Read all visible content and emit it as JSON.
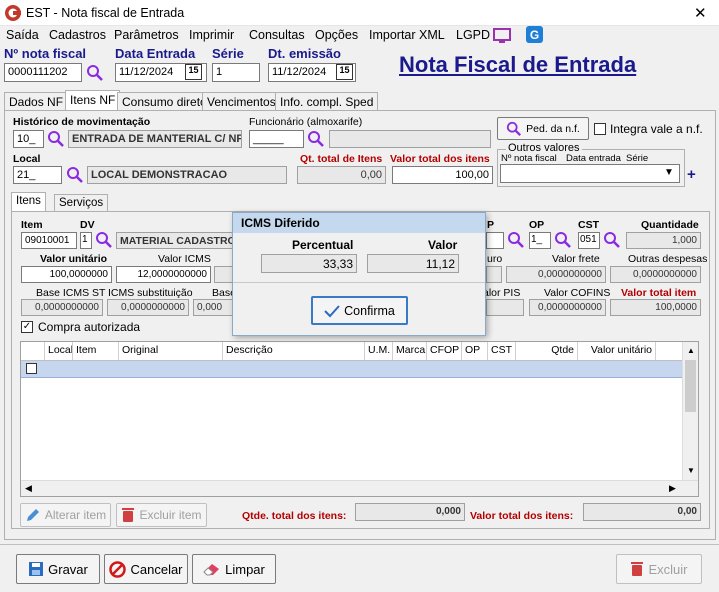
{
  "window": {
    "title": "EST - Nota fiscal de Entrada",
    "close_glyph": "✕"
  },
  "menu": [
    "Saída",
    "Cadastros",
    "Parâmetros",
    "Imprimir",
    "Consultas",
    "Opções",
    "Importar XML",
    "LGPD"
  ],
  "header": {
    "nota_label": "Nº nota fiscal",
    "nota_value": "0000111202",
    "data_entrada_label": "Data Entrada",
    "data_entrada_value": "11/12/2024",
    "serie_label": "Série",
    "serie_value": "1",
    "dt_emissao_label": "Dt. emissão",
    "dt_emissao_value": "11/12/2024",
    "calendar_badge": "15",
    "big_title": "Nota Fiscal de Entrada"
  },
  "tabs": [
    "Dados NF",
    "Itens NF",
    "Consumo direto",
    "Vencimentos",
    "Info. compl. Sped"
  ],
  "itens_nf": {
    "historico_label": "Histórico de movimentação",
    "historico_code": "10_",
    "historico_desc": "ENTRADA DE MANTERIAL C/ NF",
    "funcionario_label": "Funcionário (almoxarife)",
    "funcionario_code": "_____",
    "ped_btn": "Ped. da n.f.",
    "integra_label": "Integra vale a n.f.",
    "local_label": "Local",
    "local_code": "21_",
    "local_desc": "LOCAL DEMONSTRACAO",
    "qt_total_label": "Qt. total de Itens",
    "qt_total_value": "0,00",
    "valor_total_label": "Valor total dos itens",
    "valor_total_value": "100,00",
    "outros_label": "Outros valores",
    "nota_fiscal_col": "Nº nota fiscal",
    "data_entrada_col": "Data entrada",
    "serie_col": "Série",
    "plus": "+"
  },
  "subtabs": [
    "Itens",
    "Serviços"
  ],
  "item": {
    "item_label": "Item",
    "item_value": "09010001",
    "dv_label": "DV",
    "dv_value": "1",
    "material_desc": "MATERIAL CADASTRO",
    "p_label": "P",
    "op_label": "OP",
    "op_value": "1_",
    "cst_label": "CST",
    "cst_value": "051",
    "quantidade_label": "Quantidade",
    "quantidade_value": "1,000",
    "valor_unitario_label": "Valor unitário",
    "valor_unitario_value": "100,0000000",
    "valor_icms_label": "Valor ICMS",
    "valor_icms_value": "12,0000000000",
    "seguro_label": "uro",
    "valor_frete_label": "Valor frete",
    "valor_frete_value": "0,0000000000",
    "outras_label": "Outras despesas",
    "outras_value": "0,0000000000",
    "base_st_label": "Base ICMS ST",
    "base_st_value": "0,0000000000",
    "icms_sub_label": "ICMS substituição",
    "icms_sub_value": "0,0000000000",
    "base_label": "Base",
    "base_value": "0,000",
    "pis_label": "alor PIS",
    "cofins_label": "Valor COFINS",
    "cofins_value": "0,0000000000",
    "valor_total_item_label": "Valor total item",
    "valor_total_item_value": "100,0000",
    "compra_autorizada": "Compra autorizada"
  },
  "grid": {
    "columns": [
      "Local",
      "Item",
      "Original",
      "Descrição",
      "U.M.",
      "Marca",
      "CFOP",
      "OP",
      "CST",
      "Qtde",
      "Valor unitário"
    ]
  },
  "bottom": {
    "alterar": "Alterar item",
    "excluir_item": "Excluir item",
    "qtde_total_label": "Qtde. total dos itens:",
    "qtde_total_value": "0,000",
    "valor_total_label": "Valor total dos itens:",
    "valor_total_value": "0,00"
  },
  "footer": {
    "gravar": "Gravar",
    "cancelar": "Cancelar",
    "limpar": "Limpar",
    "excluir": "Excluir"
  },
  "dialog": {
    "title": "ICMS Diferido",
    "percentual_label": "Percentual",
    "valor_label": "Valor",
    "percentual_value": "33,33",
    "valor_value": "11,12",
    "confirma": "Confirma"
  }
}
